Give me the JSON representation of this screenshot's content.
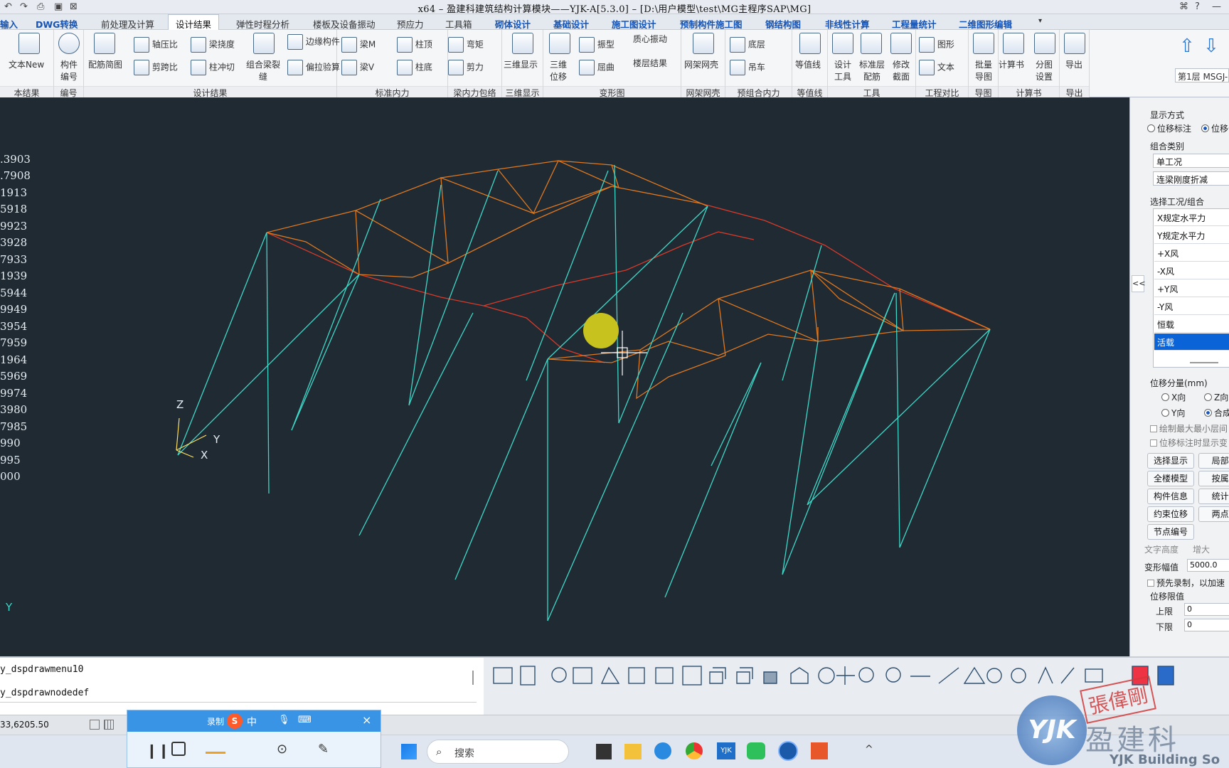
{
  "titlebar": {
    "title": "x64 – 盈建科建筑结构计算模块——YJK-A[5.3.0] – [D:\\用户模型\\test\\MG主程序SAP\\MG]"
  },
  "menubar": {
    "tabs": [
      {
        "label": "输入",
        "style": "blue"
      },
      {
        "label": "DWG转换",
        "style": "blue"
      },
      {
        "label": "前处理及计算",
        "style": "normal"
      },
      {
        "label": "设计结果",
        "style": "active"
      },
      {
        "label": "弹性时程分析",
        "style": "normal"
      },
      {
        "label": "楼板及设备振动",
        "style": "normal"
      },
      {
        "label": "预应力",
        "style": "normal"
      },
      {
        "label": "工具箱",
        "style": "normal"
      },
      {
        "label": "砌体设计",
        "style": "blue"
      },
      {
        "label": "基础设计",
        "style": "blue"
      },
      {
        "label": "施工图设计",
        "style": "blue"
      },
      {
        "label": "预制构件施工图",
        "style": "blue"
      },
      {
        "label": "钢结构图",
        "style": "blue"
      },
      {
        "label": "非线性计算",
        "style": "blue"
      },
      {
        "label": "工程量统计",
        "style": "blue"
      },
      {
        "label": "二维图形编辑",
        "style": "blue"
      }
    ]
  },
  "ribbon": {
    "groups": [
      {
        "label": "本结果",
        "items": [
          "文本New"
        ]
      },
      {
        "label": "编号",
        "items": [
          "构件编号"
        ]
      },
      {
        "label": "设计结果",
        "items": [
          "配筋简图",
          "轴压比",
          "剪跨比",
          "梁挠度",
          "柱冲切",
          "组合梁裂缝",
          "边缘构件",
          "偏拉验算"
        ]
      },
      {
        "label": "标准内力",
        "items": [
          "梁M",
          "梁V",
          "柱顶",
          "柱底"
        ]
      },
      {
        "label": "梁内力包络",
        "items": [
          "弯矩",
          "剪力"
        ]
      },
      {
        "label": "三维显示",
        "items": [
          "三维显示"
        ]
      },
      {
        "label": "变形图",
        "items": [
          "三维位移",
          "振型",
          "屈曲",
          "质心振动",
          "楼层结果"
        ]
      },
      {
        "label": "网架网壳",
        "items": [
          "网架网壳"
        ]
      },
      {
        "label": "预组合内力",
        "items": [
          "底层",
          "吊车"
        ]
      },
      {
        "label": "等值线",
        "items": [
          "等值线"
        ]
      },
      {
        "label": "工具",
        "items": [
          "设计工具",
          "标准层配筋",
          "修改截面"
        ]
      },
      {
        "label": "工程对比",
        "items": [
          "图形",
          "文本"
        ]
      },
      {
        "label": "导图",
        "items": [
          "批量导图"
        ]
      },
      {
        "label": "计算书",
        "items": [
          "计算书",
          "分图设置"
        ]
      },
      {
        "label": "导出",
        "items": [
          "导出"
        ]
      }
    ],
    "floor_selector": "第1层 MSGJ-"
  },
  "legend": {
    "values": [
      ".3903",
      ".7908",
      "1913",
      "5918",
      "9923",
      "3928",
      "7933",
      "1939",
      "5944",
      "9949",
      "3954",
      "7959",
      "1964",
      "5969",
      "9974",
      "3980",
      "7985",
      "990",
      "995",
      "000"
    ]
  },
  "axes": {
    "z": "Z",
    "y": "Y",
    "x": "X",
    "y2": "Y"
  },
  "right_panel": {
    "collapse": "<<",
    "display_mode_label": "显示方式",
    "display_opts": [
      "位移标注",
      "位移云"
    ],
    "combo_type_label": "组合类别",
    "combo_type_value": "单工况",
    "beam_stiffness_value": "连梁刚度折减",
    "select_case_label": "选择工况/组合",
    "cases": [
      "X规定水平力",
      "Y规定水平力",
      "+X风",
      "-X风",
      "+Y风",
      "-Y风",
      "恒载",
      "活载"
    ],
    "selected_case": "活载",
    "component_label": "位移分量(mm)",
    "components": [
      "X向",
      "Z向",
      "Y向",
      "合成"
    ],
    "chk1": "绘制最大最小层间",
    "chk2": "位移标注时显示变",
    "buttons": [
      "选择显示",
      "局部!",
      "全楼模型",
      "按属!",
      "构件信息",
      "统计!",
      "约束位移",
      "两点!",
      "节点编号"
    ],
    "text_height_label": "文字高度",
    "text_height_btn": "增大",
    "deform_label": "变形幅值",
    "deform_value": "5000.0",
    "prerecord": "预先录制，以加速",
    "limit_label": "位移限值",
    "upper_label": "上限",
    "upper_value": "0",
    "lower_label": "下限",
    "lower_value": "0"
  },
  "command": {
    "line1": "y_dspdrawmenu10",
    "line2": "y_dspdrawnodedef"
  },
  "status": {
    "coords": "33,6205.50"
  },
  "recorder": {
    "label": "录制",
    "ime": "中"
  },
  "taskbar": {
    "search_placeholder": "搜索",
    "yjk_label": "YJK"
  },
  "watermark": {
    "logo": "YJK",
    "company": "盈建科",
    "english": "YJK Building So",
    "stamp": "張偉剛"
  },
  "colors": {
    "canvas_bg": "#1f2a33",
    "columns": "#3fd8c8",
    "truss": "#e0781e",
    "edge": "#d83a2a",
    "selected_case": "#0a64d8",
    "cursor_marker": "#c8c21e"
  }
}
